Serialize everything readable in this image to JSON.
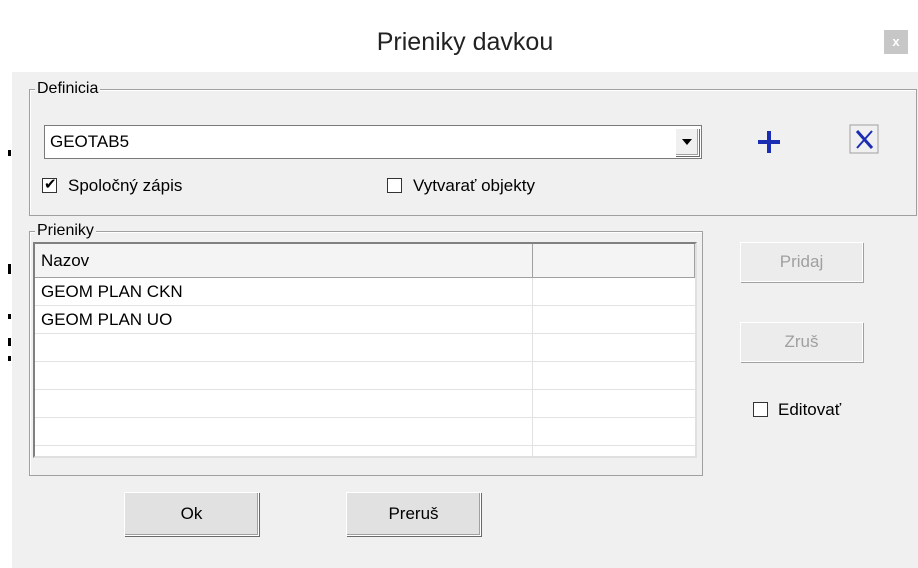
{
  "window": {
    "title": "Prieniky davkou",
    "close_label": "x"
  },
  "definicia": {
    "legend": "Definicia",
    "combo_value": "GEOTAB5",
    "add_icon": "plus-icon",
    "delete_icon": "x-icon",
    "spolocny_zapis": {
      "label": "Spoločný zápis",
      "checked": true
    },
    "vytvarat_objekty": {
      "label": "Vytvarať objekty",
      "checked": false
    }
  },
  "prieniky": {
    "legend": "Prieniky",
    "columns": [
      "Nazov",
      ""
    ],
    "rows": [
      {
        "nazov": "GEOM PLAN CKN"
      },
      {
        "nazov": "GEOM PLAN UO"
      }
    ]
  },
  "side": {
    "pridaj_label": "Pridaj",
    "zrus_label": "Zruš",
    "editovat": {
      "label": "Editovať",
      "checked": false
    }
  },
  "footer": {
    "ok_label": "Ok",
    "prerus_label": "Preruš"
  },
  "colors": {
    "plus": "#1a2db3",
    "x": "#1a2db3",
    "disabled_text": "#a0a0a0"
  }
}
